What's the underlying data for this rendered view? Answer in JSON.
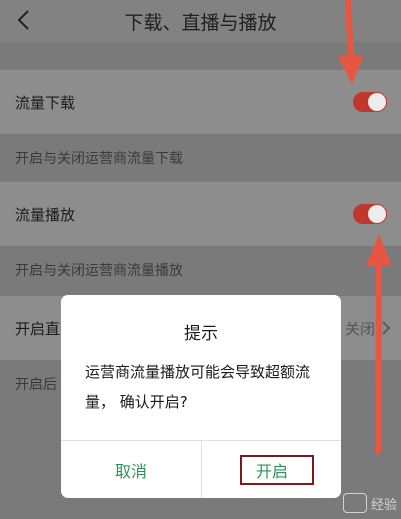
{
  "header": {
    "title": "下载、直播与播放"
  },
  "rows": {
    "download": {
      "label": "流量下载",
      "enabled": true,
      "desc": "开启与关闭运营商流量下载"
    },
    "playback": {
      "label": "流量播放",
      "enabled": true,
      "desc": "开启与关闭运营商流量播放"
    },
    "live": {
      "label_partial": "开启直",
      "value_partial": "关闭",
      "desc_partial": "开启后"
    }
  },
  "dialog": {
    "title": "提示",
    "message": "运营商流量播放可能会导致超额流量， 确认开启?",
    "cancel_label": "取消",
    "confirm_label": "开启"
  },
  "colors": {
    "toggle_on": "#c0382b",
    "dialog_button": "#2a9456",
    "arrow": "#e85540",
    "highlight_border": "#7a1a1a"
  },
  "watermark": {
    "text": "经验"
  }
}
